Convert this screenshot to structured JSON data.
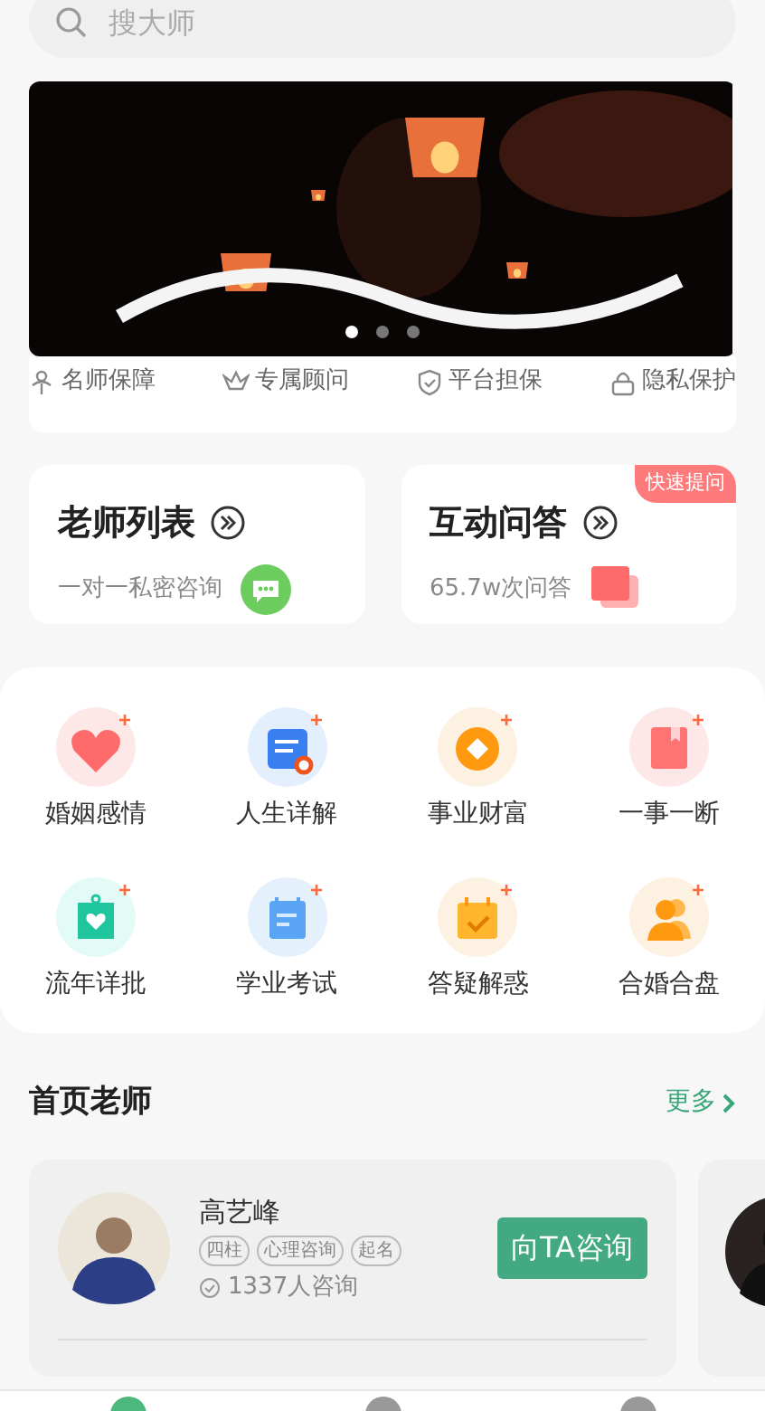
{
  "search": {
    "placeholder": "搜大师"
  },
  "banner": {
    "kind": "picture",
    "dots": [
      {
        "selected": true
      },
      {
        "selected": false
      },
      {
        "selected": false
      }
    ]
  },
  "guarantees": [
    {
      "label": "名师保障",
      "kind": "person"
    },
    {
      "label": "专属顾问",
      "kind": "crown"
    },
    {
      "label": "平台担保",
      "kind": "shield"
    },
    {
      "label": "隐私保护",
      "kind": "lock"
    }
  ],
  "entries": [
    {
      "title": "老师列表",
      "subtitle": "一对一私密咨询",
      "kind": "chat"
    },
    {
      "title": "互动问答",
      "subtitle": "65.7w次问答",
      "kind": "question",
      "badge": "快速提问"
    }
  ],
  "categories": [
    {
      "label": "婚姻感情",
      "kind": "heart"
    },
    {
      "label": "人生详解",
      "kind": "doc"
    },
    {
      "label": "事业财富",
      "kind": "coin"
    },
    {
      "label": "一事一断",
      "kind": "book"
    },
    {
      "label": "流年详批",
      "kind": "bag"
    },
    {
      "label": "学业考试",
      "kind": "calendar"
    },
    {
      "label": "答疑解惑",
      "kind": "check"
    },
    {
      "label": "合婚合盘",
      "kind": "people"
    }
  ],
  "section": {
    "title": "首页老师",
    "more": "更多"
  },
  "teachers": [
    {
      "name": "高艺峰",
      "tags": [
        "四柱",
        "心理咨询",
        "起名"
      ],
      "consults": "1337人咨询",
      "button": "向TA咨询"
    }
  ],
  "tabbar": [
    {
      "selected": true
    },
    {
      "selected": false
    },
    {
      "selected": false
    }
  ]
}
